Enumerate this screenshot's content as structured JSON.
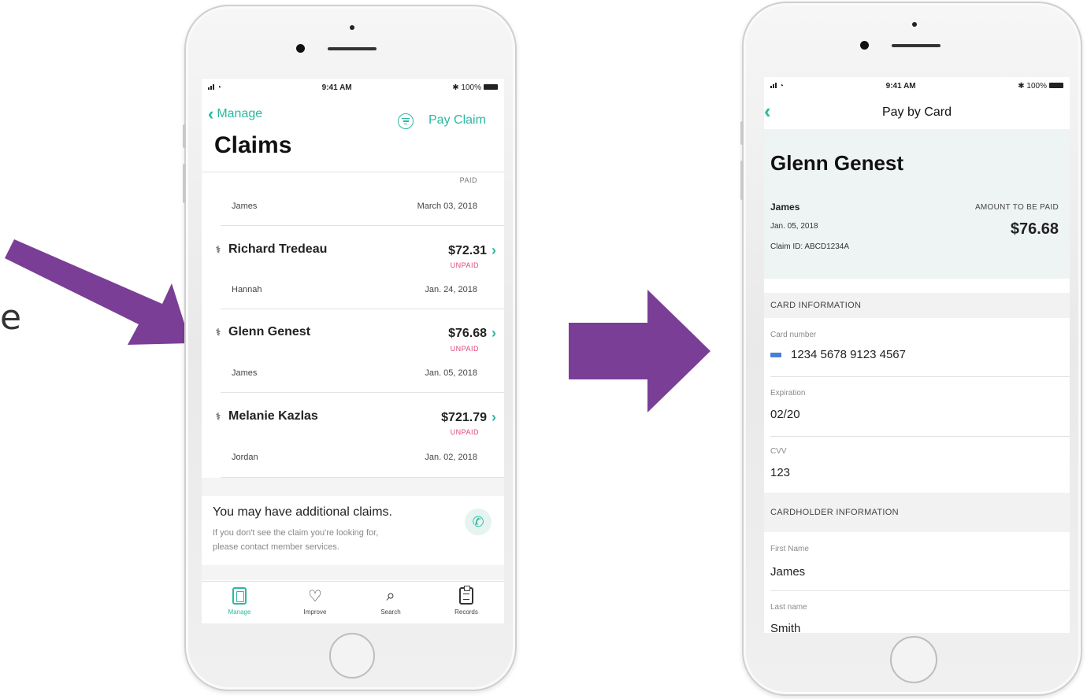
{
  "colors": {
    "accent": "#2bb8a0",
    "unpaid": "#e0457b",
    "arrow": "#7a3e96"
  },
  "edge_letter": "e",
  "left_phone": {
    "status": {
      "time": "9:41 AM",
      "battery": "100%"
    },
    "header": {
      "back_label": "Manage",
      "action_label": "Pay Claim",
      "title": "Claims",
      "filter_icon": "filter-icon"
    },
    "first_row": {
      "status": "PAID",
      "subscriber": "James",
      "date": "March 03, 2018"
    },
    "claims": [
      {
        "name": "Richard Tredeau",
        "amount": "$72.31",
        "status": "UNPAID",
        "subscriber": "Hannah",
        "date": "Jan. 24, 2018"
      },
      {
        "name": "Glenn Genest",
        "amount": "$76.68",
        "status": "UNPAID",
        "subscriber": "James",
        "date": "Jan. 05, 2018"
      },
      {
        "name": "Melanie Kazlas",
        "amount": "$721.79",
        "status": "UNPAID",
        "subscriber": "Jordan",
        "date": "Jan. 02, 2018"
      }
    ],
    "info": {
      "title": "You may have additional claims.",
      "line1": "If you don't see the claim you're looking for,",
      "line2": "please contact member services."
    },
    "tabs": [
      {
        "label": "Manage",
        "icon": "document-icon",
        "active": true
      },
      {
        "label": "Improve",
        "icon": "heart-icon",
        "active": false
      },
      {
        "label": "Search",
        "icon": "search-icon",
        "active": false
      },
      {
        "label": "Records",
        "icon": "clipboard-icon",
        "active": false
      }
    ]
  },
  "right_phone": {
    "status": {
      "time": "9:41 AM",
      "battery": "100%"
    },
    "header": {
      "title": "Pay by Card"
    },
    "summary": {
      "patient": "Glenn Genest",
      "subscriber": "James",
      "date": "Jan. 05, 2018",
      "claim_id": "Claim ID: ABCD1234A",
      "amount_label": "AMOUNT TO BE PAID",
      "amount": "$76.68"
    },
    "card_section": {
      "title": "CARD INFORMATION",
      "card_number_label": "Card number",
      "card_number": "1234 5678 9123 4567",
      "expiration_label": "Expiration",
      "expiration": "02/20",
      "cvv_label": "CVV",
      "cvv": "123"
    },
    "holder_section": {
      "title": "CARDHOLDER INFORMATION",
      "first_name_label": "First Name",
      "first_name": "James",
      "last_name_label": "Last name",
      "last_name": "Smith"
    }
  }
}
